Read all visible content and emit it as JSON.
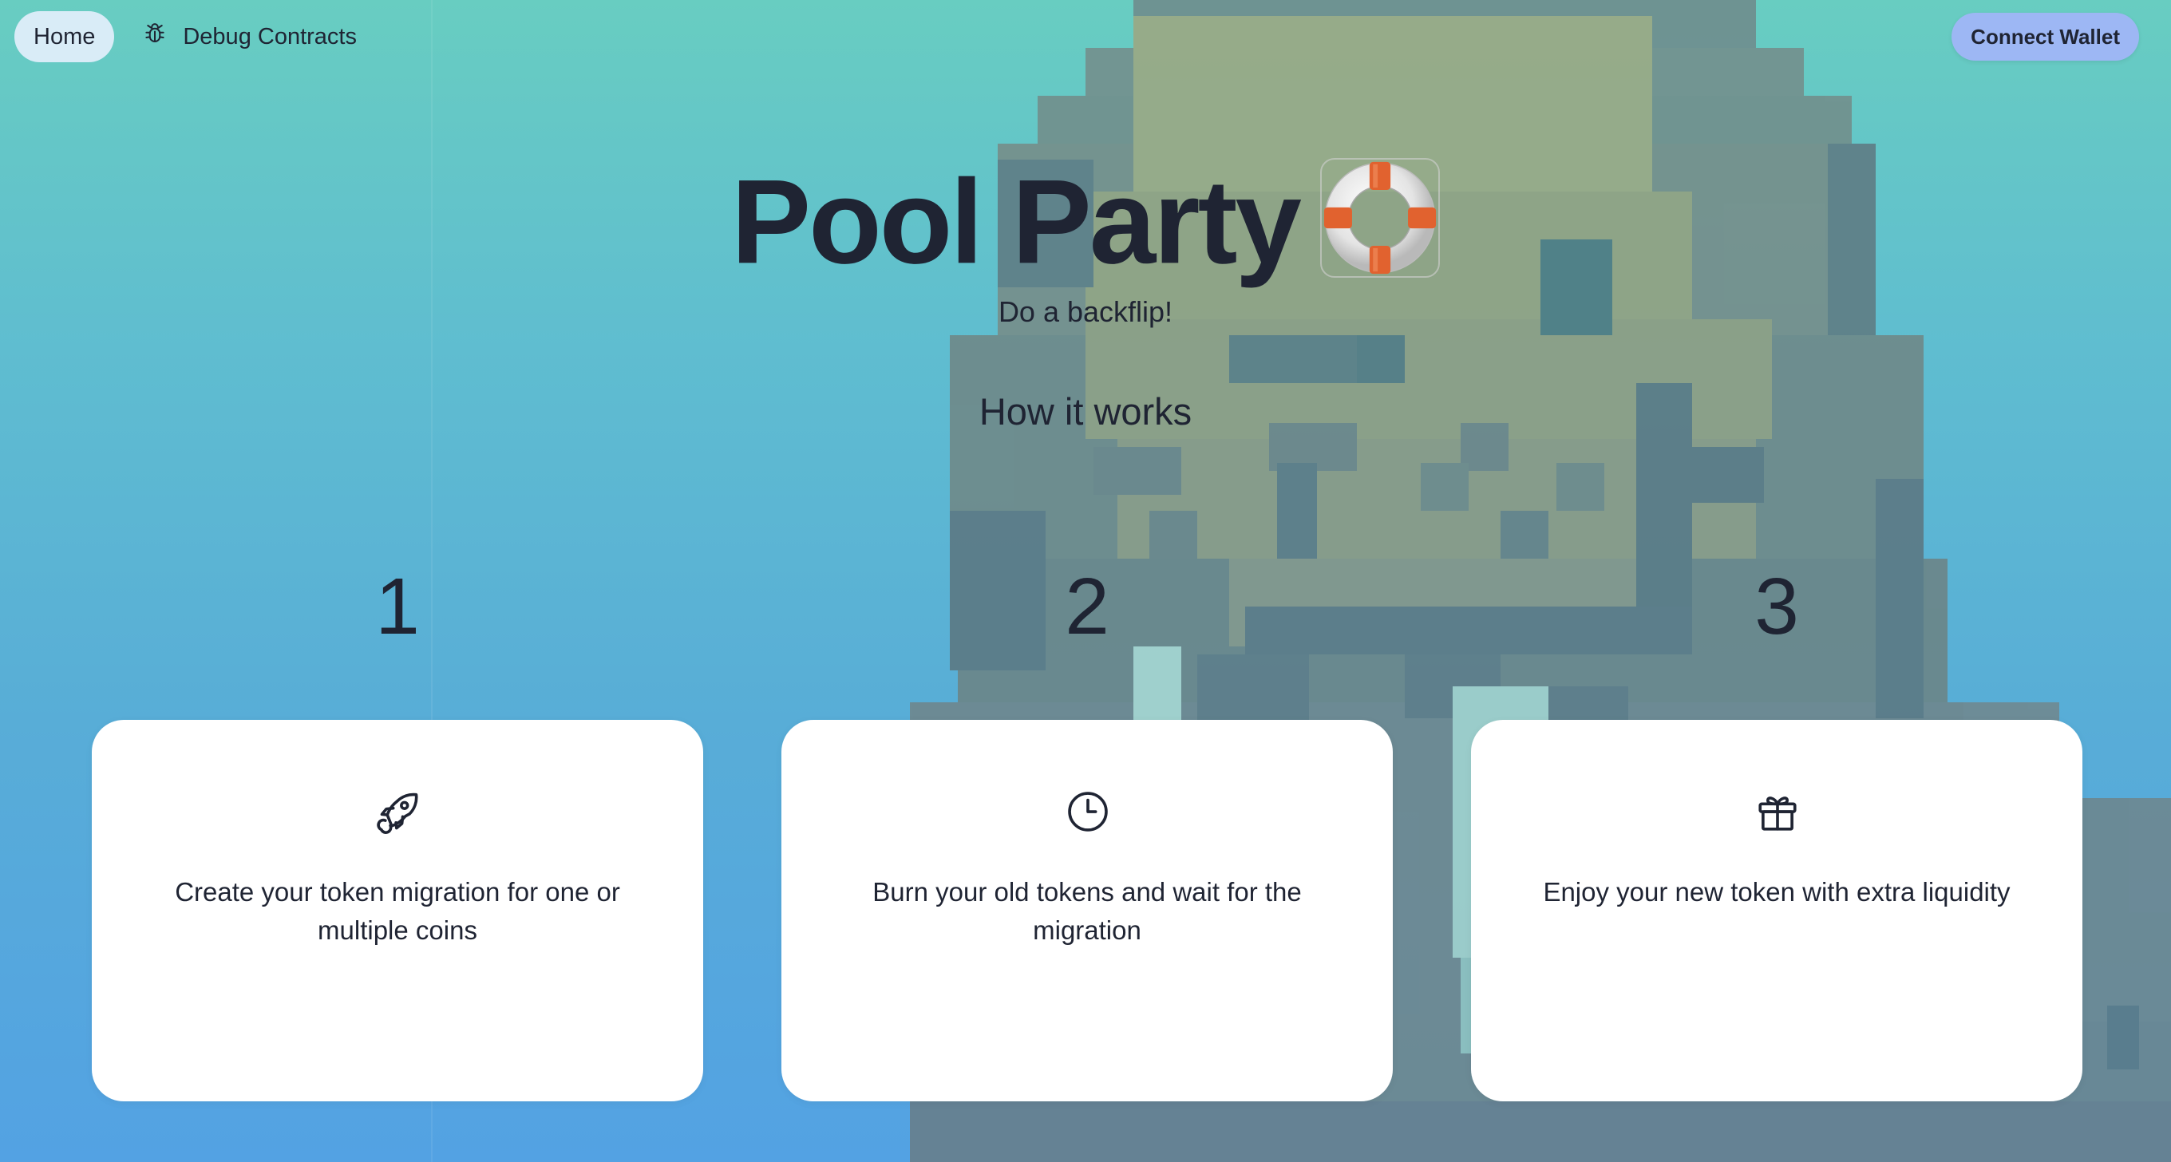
{
  "nav": {
    "home_label": "Home",
    "debug_label": "Debug Contracts",
    "debug_icon": "bug-icon"
  },
  "header": {
    "connect_wallet_label": "Connect Wallet"
  },
  "hero": {
    "title": "Pool Party",
    "title_icon": "life-ring-icon",
    "tagline": "Do a backflip!"
  },
  "how_it_works": {
    "heading": "How it works",
    "steps": [
      {
        "number": "1",
        "icon": "rocket-icon",
        "text": "Create your token migration for one or multiple coins"
      },
      {
        "number": "2",
        "icon": "clock-icon",
        "text": "Burn your old tokens and wait for the migration"
      },
      {
        "number": "3",
        "icon": "gift-icon",
        "text": "Enjoy your new token with extra liquidity"
      }
    ]
  },
  "colors": {
    "background_top": "#68cdc1",
    "background_bottom": "#53a2e3",
    "home_pill": "#d9ecf7",
    "connect_wallet_bg": "#9db7f4",
    "text": "#1f2433",
    "card_bg": "#ffffff"
  }
}
